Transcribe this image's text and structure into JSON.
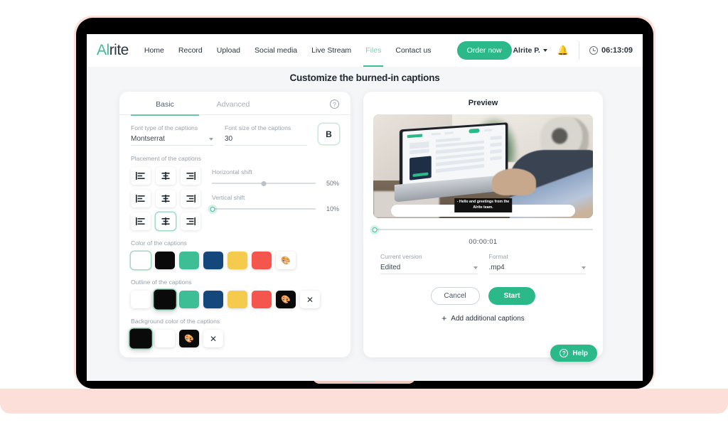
{
  "nav": {
    "logo_a": "Al",
    "logo_b": "rite",
    "links": [
      {
        "label": "Home",
        "active": false
      },
      {
        "label": "Record",
        "active": false
      },
      {
        "label": "Upload",
        "active": false
      },
      {
        "label": "Social media",
        "active": false
      },
      {
        "label": "Live Stream",
        "active": false
      },
      {
        "label": "Files",
        "active": true
      },
      {
        "label": "Contact us",
        "active": false
      }
    ],
    "order_button": "Order now",
    "user": "Alrite P.",
    "bell_icon": "bell-icon",
    "clock_icon": "clock-icon",
    "timer": "06:13:09"
  },
  "page": {
    "title": "Customize the burned-in captions"
  },
  "settings": {
    "tabs": [
      {
        "label": "Basic",
        "active": true
      },
      {
        "label": "Advanced",
        "active": false
      }
    ],
    "help_icon": "question-mark-icon",
    "font_type": {
      "label": "Font type of the captions",
      "value": "Montserrat"
    },
    "font_size": {
      "label": "Font size of the captions",
      "value": "30"
    },
    "bold_button": "B",
    "placement": {
      "label": "Placement of the captions",
      "cells": [
        {
          "name": "align-top-left",
          "glyph": "left",
          "selected": false
        },
        {
          "name": "align-top-center",
          "glyph": "center",
          "selected": false
        },
        {
          "name": "align-top-right",
          "glyph": "right",
          "selected": false
        },
        {
          "name": "align-middle-left",
          "glyph": "left",
          "selected": false
        },
        {
          "name": "align-middle-center",
          "glyph": "center",
          "selected": false
        },
        {
          "name": "align-middle-right",
          "glyph": "right",
          "selected": false
        },
        {
          "name": "align-bottom-left",
          "glyph": "left",
          "selected": false
        },
        {
          "name": "align-bottom-center",
          "glyph": "center",
          "selected": true
        },
        {
          "name": "align-bottom-right",
          "glyph": "right",
          "selected": false
        }
      ]
    },
    "horizontal_shift": {
      "label": "Horizontal shift",
      "value": "50%",
      "pos": 50
    },
    "vertical_shift": {
      "label": "Vertical shift",
      "value": "10%",
      "pos": 10
    },
    "caption_color": {
      "label": "Color of the captions",
      "swatches": [
        {
          "name": "color-white",
          "hex": "#FFFFFF",
          "selected": true
        },
        {
          "name": "color-black",
          "hex": "#0A0A0A",
          "selected": false
        },
        {
          "name": "color-green",
          "hex": "#3DBE94",
          "selected": false
        },
        {
          "name": "color-navy",
          "hex": "#14477B",
          "selected": false
        },
        {
          "name": "color-yellow",
          "hex": "#F5CB4D",
          "selected": false
        },
        {
          "name": "color-red",
          "hex": "#F4564E",
          "selected": false
        }
      ],
      "palette_icon": "palette-icon"
    },
    "outline_color": {
      "label": "Outline of the captions",
      "swatches": [
        {
          "name": "outline-white",
          "hex": "#FFFFFF",
          "selected": false
        },
        {
          "name": "outline-black",
          "hex": "#0A0A0A",
          "selected": true
        },
        {
          "name": "outline-green",
          "hex": "#3DBE94",
          "selected": false
        },
        {
          "name": "outline-navy",
          "hex": "#14477B",
          "selected": false
        },
        {
          "name": "outline-yellow",
          "hex": "#F5CB4D",
          "selected": false
        },
        {
          "name": "outline-red",
          "hex": "#F4564E",
          "selected": false
        }
      ],
      "palette_icon": "palette-icon",
      "clear_icon": "close-icon"
    },
    "background_color": {
      "label": "Background color of the captions",
      "swatches": [
        {
          "name": "bg-black",
          "hex": "#0A0A0A",
          "selected": true
        },
        {
          "name": "bg-white",
          "hex": "#FFFFFF",
          "selected": false
        }
      ],
      "palette_icon": "palette-icon",
      "clear_icon": "close-icon"
    }
  },
  "preview": {
    "title": "Preview",
    "caption_overlay": "- Hello and greetings from the\nAlrite team.",
    "timecode": "00:00:01",
    "current_version": {
      "label": "Current version",
      "value": "Edited"
    },
    "format": {
      "label": "Format",
      "value": ".mp4"
    },
    "cancel_button": "Cancel",
    "start_button": "Start",
    "add_captions": "Add additional captions",
    "plus_icon": "plus-icon"
  },
  "help_fab": {
    "label": "Help",
    "icon": "question-mark-icon"
  },
  "colors": {
    "accent": "#2BB98A",
    "accent_light": "#9FDCC2",
    "text_dark": "#1F2730",
    "muted": "#9AA2AB",
    "pink_base": "#FBDFD8"
  }
}
